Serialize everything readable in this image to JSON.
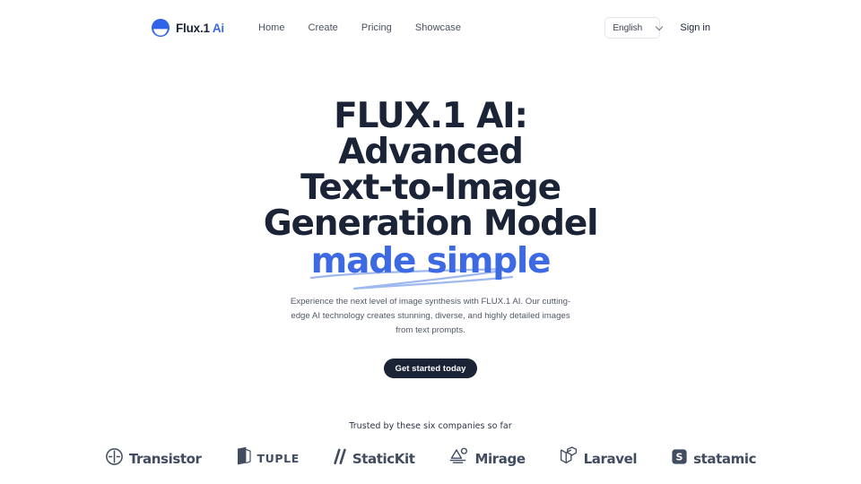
{
  "header": {
    "brand": {
      "name": "Flux.1",
      "accent": "Ai",
      "icon": "flux-circle-logo"
    },
    "nav": [
      {
        "label": "Home"
      },
      {
        "label": "Create"
      },
      {
        "label": "Pricing"
      },
      {
        "label": "Showcase"
      }
    ],
    "language": {
      "value": "English",
      "icon": "chevron-down-icon"
    },
    "signin_label": "Sign in"
  },
  "hero": {
    "title_line1": "FLUX.1 AI: Advanced",
    "title_line2": "Text-to-Image",
    "title_line3": "Generation Model",
    "title_accent": "made simple",
    "subtitle": "Experience the next level of image synthesis with FLUX.1 AI. Our cutting-edge AI technology creates stunning, diverse, and highly detailed images from text prompts.",
    "cta_label": "Get started today"
  },
  "trusted": {
    "label": "Trusted by these six companies so far",
    "logos": [
      {
        "name": "Transistor",
        "icon": "transistor-icon",
        "style": "normal"
      },
      {
        "name": "TUPLE",
        "icon": "tuple-icon",
        "style": "tracked"
      },
      {
        "name": "StaticKit",
        "icon": "statickit-icon",
        "style": "normal"
      },
      {
        "name": "Mirage",
        "icon": "mirage-icon",
        "style": "normal"
      },
      {
        "name": "Laravel",
        "icon": "laravel-icon",
        "style": "normal"
      },
      {
        "name": "statamic",
        "icon": "statamic-icon",
        "style": "normal"
      }
    ]
  },
  "colors": {
    "accent_blue": "#3d6ae3",
    "swoosh_blue": "#93b1ef",
    "ink": "#1b2437",
    "muted": "#51586a",
    "logo_gray": "#414c60",
    "background": "#ffffff"
  }
}
